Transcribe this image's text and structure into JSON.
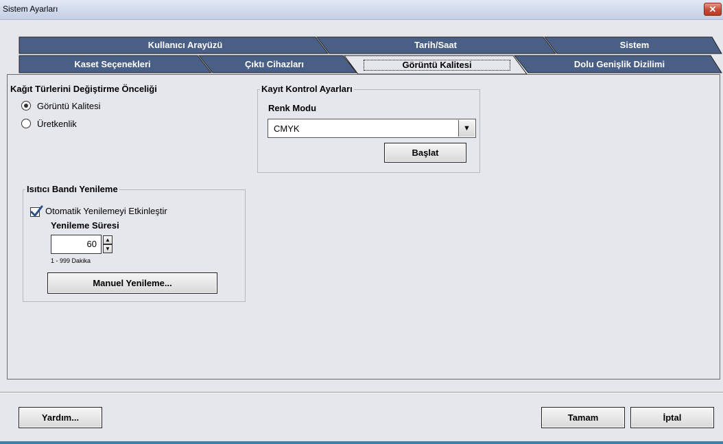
{
  "window": {
    "title": "Sistem Ayarları",
    "close_symbol": "✕"
  },
  "tabs": {
    "row1": [
      {
        "label": "Kullanıcı Arayüzü"
      },
      {
        "label": "Tarih/Saat"
      },
      {
        "label": "Sistem"
      }
    ],
    "row2": [
      {
        "label": "Kaset Seçenekleri"
      },
      {
        "label": "Çıktı Cihazları"
      },
      {
        "label": "Görüntü Kalitesi",
        "active": true
      },
      {
        "label": "Dolu Genişlik Dizilimi"
      }
    ]
  },
  "paper_priority": {
    "heading": "Kağıt Türlerini Değiştirme Önceliği",
    "options": [
      {
        "label": "Görüntü Kalitesi",
        "selected": true
      },
      {
        "label": "Üretkenlik",
        "selected": false
      }
    ]
  },
  "registration_control": {
    "legend": "Kayıt Kontrol Ayarları",
    "color_mode_label": "Renk Modu",
    "color_mode_value": "CMYK",
    "start_button": "Başlat"
  },
  "fuser_belt_refresh": {
    "legend": "Isıtıcı Bandı Yenileme",
    "auto_refresh_label": "Otomatik Yenilemeyi Etkinleştir",
    "auto_refresh_checked": true,
    "refresh_time_label": "Yenileme Süresi",
    "refresh_time_value": "60",
    "range_hint": "1 - 999 Dakika",
    "manual_refresh_button": "Manuel Yenileme..."
  },
  "footer": {
    "help_button": "Yardım...",
    "ok_button": "Tamam",
    "cancel_button": "İptal"
  },
  "colors": {
    "tab_fill": "#4a5f86",
    "active_tab_fill": "#e6e7ec",
    "background": "#e6e7ec",
    "close_button": "#c44b36",
    "accent_line": "#3f7fa8"
  }
}
